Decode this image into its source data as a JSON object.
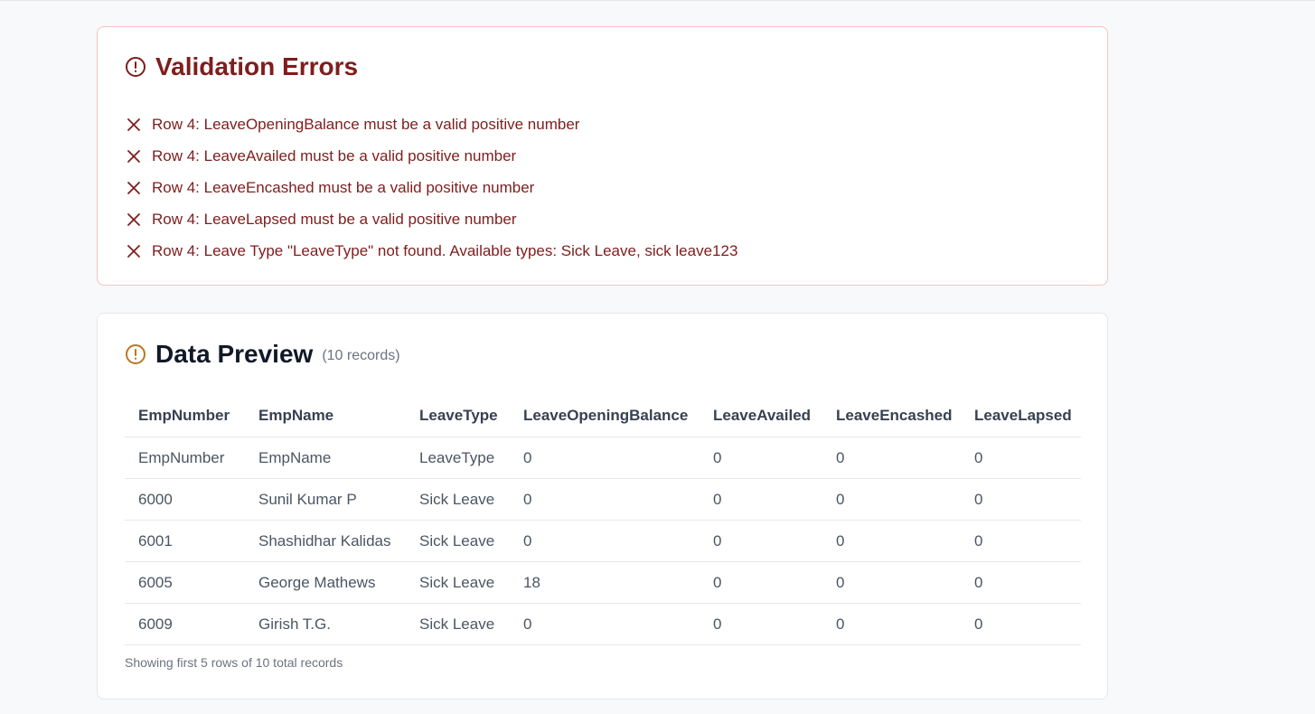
{
  "colors": {
    "error": "#7f1d1d",
    "warning": "#b7791f",
    "border": "#e5e7eb"
  },
  "validation": {
    "title": "Validation Errors",
    "icon": "alert-circle-icon",
    "errors": [
      "Row 4: LeaveOpeningBalance must be a valid positive number",
      "Row 4: LeaveAvailed must be a valid positive number",
      "Row 4: LeaveEncashed must be a valid positive number",
      "Row 4: LeaveLapsed must be a valid positive number",
      "Row 4: Leave Type \"LeaveType\" not found. Available types: Sick Leave, sick leave123"
    ]
  },
  "preview": {
    "title": "Data Preview",
    "icon": "alert-circle-icon",
    "record_count": "(10 records)",
    "columns": [
      "EmpNumber",
      "EmpName",
      "LeaveType",
      "LeaveOpeningBalance",
      "LeaveAvailed",
      "LeaveEncashed",
      "LeaveLapsed"
    ],
    "rows": [
      [
        "EmpNumber",
        "EmpName",
        "LeaveType",
        "0",
        "0",
        "0",
        "0"
      ],
      [
        "6000",
        "Sunil Kumar P",
        "Sick Leave",
        "0",
        "0",
        "0",
        "0"
      ],
      [
        "6001",
        "Shashidhar Kalidas",
        "Sick Leave",
        "0",
        "0",
        "0",
        "0"
      ],
      [
        "6005",
        "George Mathews",
        "Sick Leave",
        "18",
        "0",
        "0",
        "0"
      ],
      [
        "6009",
        "Girish T.G.",
        "Sick Leave",
        "0",
        "0",
        "0",
        "0"
      ]
    ],
    "footnote": "Showing first 5 rows of 10 total records"
  }
}
